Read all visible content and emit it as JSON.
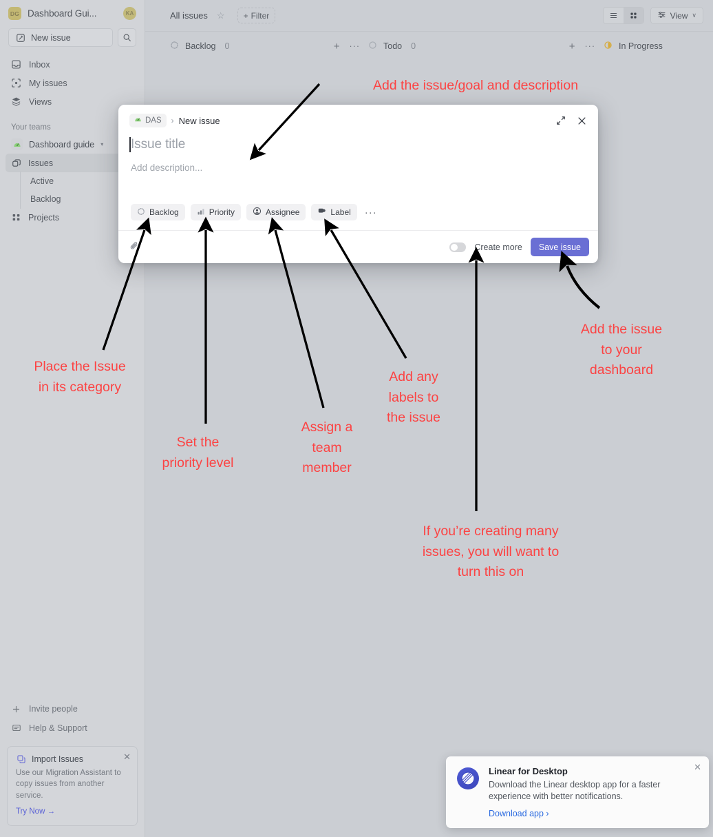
{
  "sidebar": {
    "workspace": {
      "badge": "DG",
      "name": "Dashboard Gui...",
      "avatar": "KA"
    },
    "new_issue_label": "New issue",
    "search_icon": "search-icon",
    "nav": [
      {
        "label": "Inbox",
        "icon": "inbox-icon"
      },
      {
        "label": "My issues",
        "icon": "my-issues-icon"
      },
      {
        "label": "Views",
        "icon": "views-icon"
      }
    ],
    "teams_label": "Your teams",
    "team": {
      "name": "Dashboard guide",
      "emoji": "🎡",
      "caret": "▾"
    },
    "team_items": [
      {
        "label": "Issues",
        "icon": "issues-icon",
        "active": true
      },
      {
        "label": "Active",
        "sub": true
      },
      {
        "label": "Backlog",
        "sub": true
      },
      {
        "label": "Projects",
        "icon": "projects-icon"
      }
    ],
    "bottom": [
      {
        "label": "Invite people",
        "icon": "plus-icon"
      },
      {
        "label": "Help & Support",
        "icon": "help-icon"
      }
    ],
    "import_card": {
      "title": "Import Issues",
      "body": "Use our Migration Assistant to copy issues from another service.",
      "link": "Try Now →",
      "close": "✕"
    }
  },
  "topbar": {
    "title": "All issues",
    "star": "☆",
    "filter_label": "Filter",
    "view_label": "View",
    "view_caret": "∨"
  },
  "board": {
    "columns": [
      {
        "name": "Backlog",
        "count": "0",
        "status": "backlog"
      },
      {
        "name": "Todo",
        "count": "0",
        "status": "todo"
      },
      {
        "name": "In Progress",
        "count": "",
        "status": "in-progress"
      }
    ],
    "add_symbol": "+",
    "more_symbol": "···"
  },
  "modal": {
    "team_chip": "DAS",
    "separator": "›",
    "breadcrumb_current": "New issue",
    "expand_icon": "expand-icon",
    "close_icon": "close-icon",
    "title_placeholder": "Issue title",
    "description_placeholder": "Add description...",
    "chips": [
      {
        "label": "Backlog",
        "icon": "backlog-status-icon"
      },
      {
        "label": "Priority",
        "icon": "priority-bars-icon"
      },
      {
        "label": "Assignee",
        "icon": "assignee-avatar-icon"
      },
      {
        "label": "Label",
        "icon": "label-tag-icon"
      }
    ],
    "more_chip": "···",
    "attachment_icon": "paperclip-icon",
    "create_more_label": "Create more",
    "create_more_on": false,
    "save_label": "Save issue",
    "save_color": "#6a6fd4"
  },
  "annotations": {
    "color": "#fc4343",
    "notes": [
      {
        "id": "note-title-desc",
        "text": "Add the issue/goal and description"
      },
      {
        "id": "note-category",
        "text": "Place the Issue\nin its category"
      },
      {
        "id": "note-priority",
        "text": "Set the\npriority level"
      },
      {
        "id": "note-assignee",
        "text": "Assign a\nteam\nmember"
      },
      {
        "id": "note-labels",
        "text": "Add any\nlabels to\nthe issue"
      },
      {
        "id": "note-save",
        "text": "Add the issue\nto your\ndashboard"
      },
      {
        "id": "note-create-more",
        "text": "If you’re creating many\nissues, you will want to\nturn this on"
      }
    ]
  },
  "toast": {
    "title": "Linear for Desktop",
    "body": "Download the Linear desktop app for a faster experience with better notifications.",
    "link": "Download app ›",
    "close": "✕"
  }
}
